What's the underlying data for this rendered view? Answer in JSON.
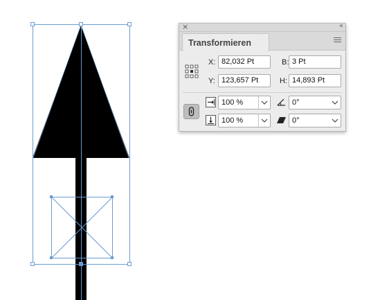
{
  "canvas": {
    "shape": "arrow-shape",
    "selection_color": "#6a9bd0"
  },
  "panel": {
    "tab_title": "Transformieren",
    "icons": {
      "close": "close-icon",
      "collapse": "collapse-icon",
      "menu": "panel-menu-icon",
      "reference_point": "reference-point-icon",
      "link": "constrain-proportions-icon",
      "scale_x": "scale-x-icon",
      "scale_y": "scale-y-icon",
      "rotate": "rotate-icon",
      "shear": "shear-icon",
      "dropdown": "chevron-down-icon"
    },
    "fields": {
      "x_label": "X:",
      "x_value": "82,032 Pt",
      "y_label": "Y:",
      "y_value": "123,657 Pt",
      "b_label": "B:",
      "b_value": "3 Pt",
      "h_label": "H:",
      "h_value": "14,893 Pt"
    },
    "scale_x": "100 %",
    "scale_y": "100 %",
    "rotate": "0°",
    "shear": "0°"
  }
}
